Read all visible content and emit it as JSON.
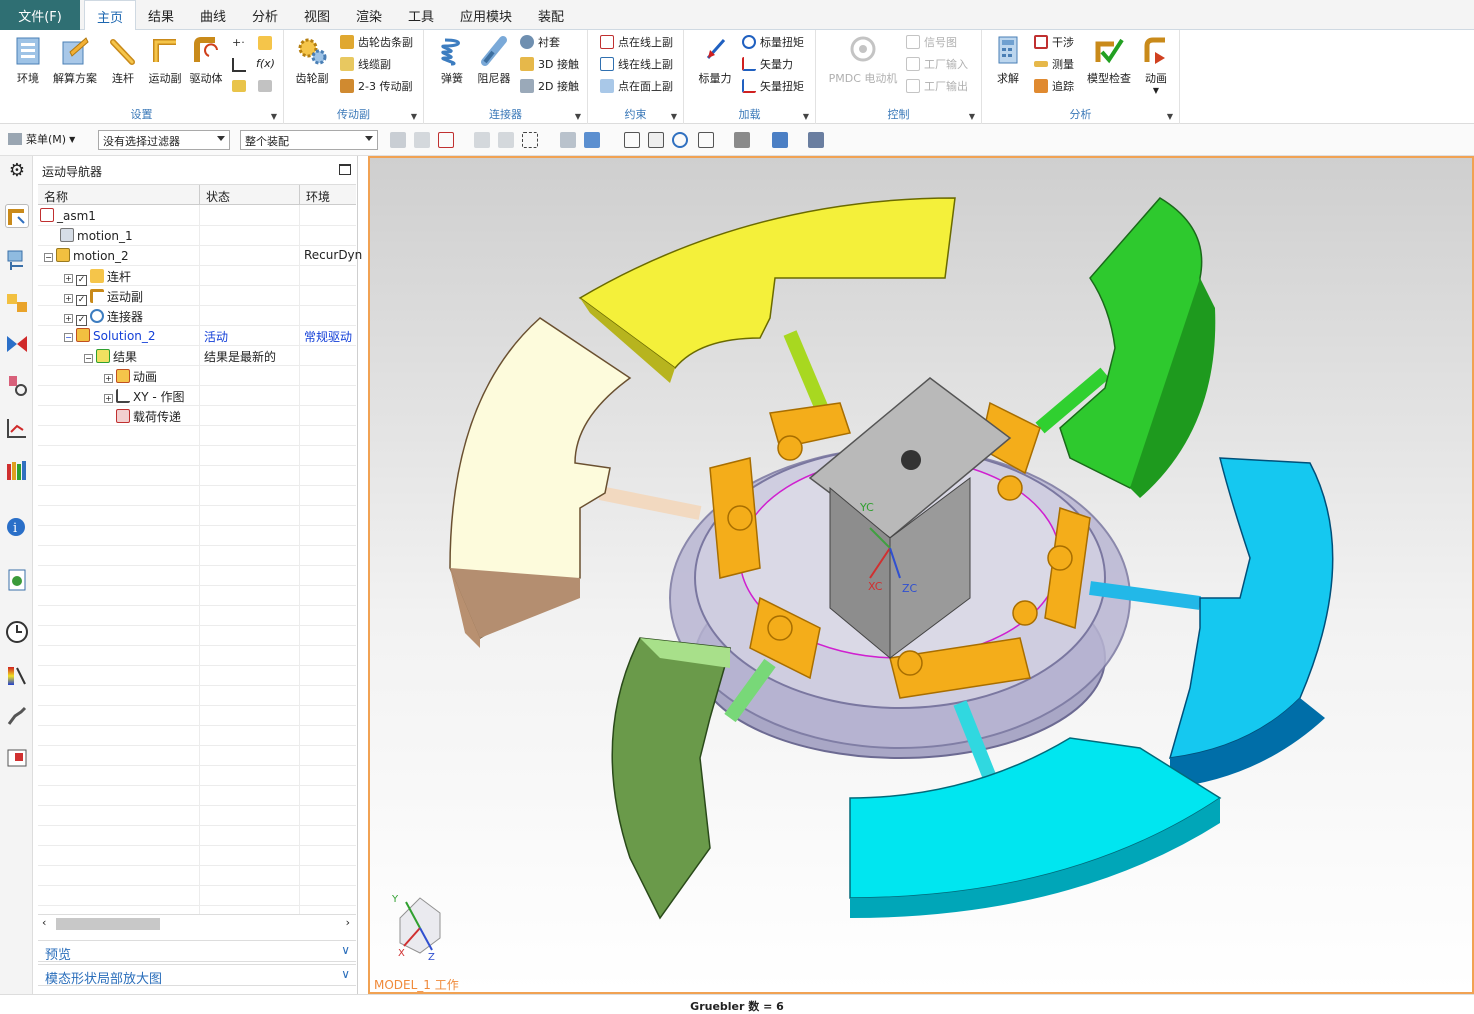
{
  "menubar": {
    "file": "文件(F)",
    "tabs": [
      "主页",
      "结果",
      "曲线",
      "分析",
      "视图",
      "渲染",
      "工具",
      "应用模块",
      "装配"
    ],
    "active_tab": "主页"
  },
  "ribbon": {
    "groups": {
      "setup": {
        "label": "设置",
        "buttons": [
          "环境",
          "解算方案",
          "连杆",
          "运动副",
          "驱动体"
        ]
      },
      "transmission": {
        "label": "传动副",
        "big": "齿轮副",
        "small": [
          "齿轮齿条副",
          "线缆副",
          "2-3 传动副"
        ]
      },
      "connector": {
        "label": "连接器",
        "big": [
          "弹簧",
          "阻尼器"
        ],
        "small": [
          "衬套",
          "3D 接触",
          "2D 接触"
        ]
      },
      "constraint": {
        "label": "约束",
        "small": [
          "点在线上副",
          "线在线上副",
          "点在面上副"
        ]
      },
      "load": {
        "label": "加载",
        "big": "标量力",
        "small": [
          "标量扭矩",
          "矢量力",
          "矢量扭矩"
        ]
      },
      "control": {
        "label": "控制",
        "big": "PMDC 电动机",
        "small": [
          "信号图",
          "工厂输入",
          "工厂输出"
        ]
      },
      "analysis": {
        "label": "分析",
        "big": [
          "求解",
          "模型检查",
          "动画"
        ],
        "small": [
          "干涉",
          "测量",
          "追踪"
        ]
      }
    }
  },
  "toolbar": {
    "menu": "菜单(M)",
    "filter": "没有选择过滤器",
    "scope": "整个装配"
  },
  "navigator": {
    "title": "运动导航器",
    "columns": [
      "名称",
      "状态",
      "环境"
    ],
    "rows": [
      {
        "name": "_asm1",
        "status": "",
        "env": ""
      },
      {
        "name": "motion_1",
        "status": "",
        "env": ""
      },
      {
        "name": "motion_2",
        "status": "",
        "env": "RecurDyn"
      },
      {
        "name": "连杆",
        "status": "",
        "env": ""
      },
      {
        "name": "运动副",
        "status": "",
        "env": ""
      },
      {
        "name": "连接器",
        "status": "",
        "env": ""
      },
      {
        "name": "Solution_2",
        "status": "活动",
        "env": "常规驱动"
      },
      {
        "name": "结果",
        "status": "结果是最新的",
        "env": ""
      },
      {
        "name": "动画",
        "status": "",
        "env": ""
      },
      {
        "name": "XY - 作图",
        "status": "",
        "env": ""
      },
      {
        "name": "载荷传递",
        "status": "",
        "env": ""
      }
    ],
    "panels": [
      "预览",
      "模态形状局部放大图"
    ]
  },
  "viewport": {
    "model_label": "MODEL_1 工作",
    "axes": {
      "yc": "YC",
      "xc": "XC",
      "zc": "ZC",
      "x": "X",
      "y": "Y",
      "z": "Z"
    }
  },
  "status": {
    "text": "Gruebler 数 = 6"
  },
  "colors": {
    "accent": "#1d67b0",
    "file_button": "#2f6f73",
    "viewport_border": "#f1a253",
    "link_text": "#1440d8"
  }
}
